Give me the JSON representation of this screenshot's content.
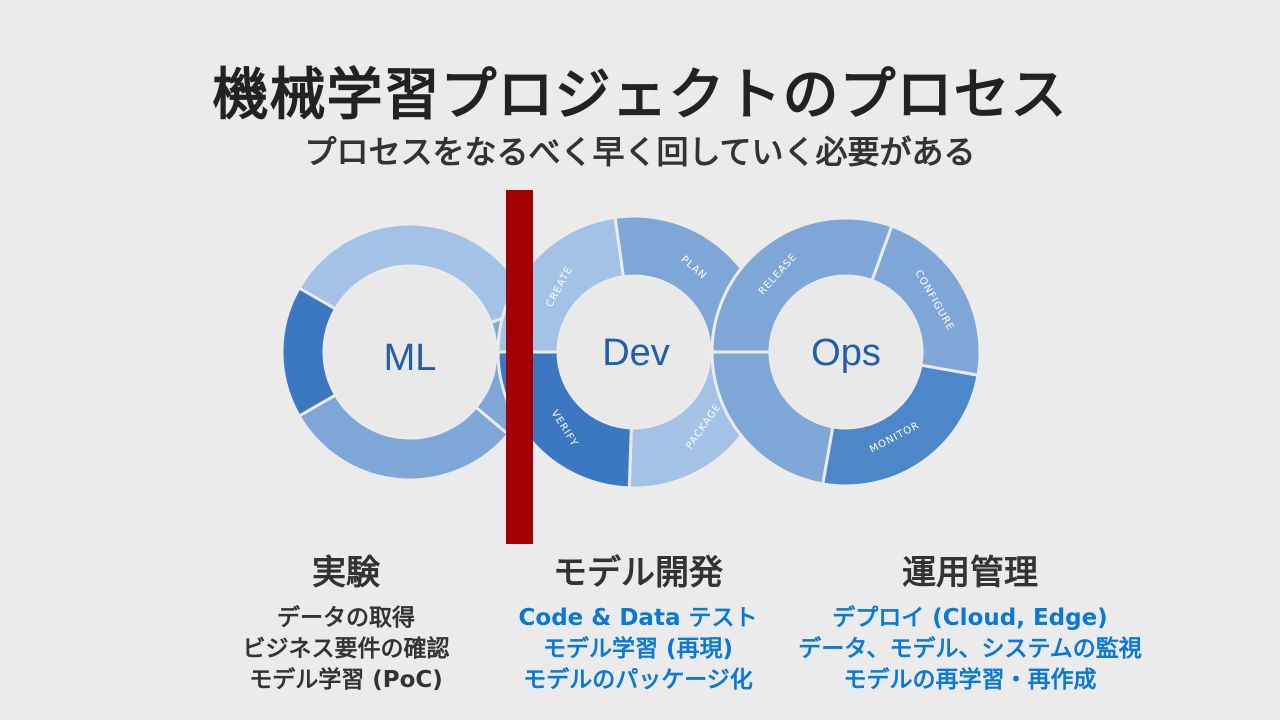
{
  "title": "機械学習プロジェクトのプロセス",
  "subtitle": "プロセスをなるべく早く回していく必要がある",
  "loops": {
    "ml": "ML",
    "dev": "Dev",
    "ops": "Ops"
  },
  "stages": {
    "create": "CREATE",
    "plan": "PLAN",
    "verify": "VERIFY",
    "package": "PACKAGE",
    "release": "RELEASE",
    "configure": "CONFIGURE",
    "monitor": "MONITOR"
  },
  "columns": [
    {
      "heading": "実験",
      "items": [
        "データの取得",
        "ビジネス要件の確認",
        "モデル学習 (PoC)"
      ]
    },
    {
      "heading": "モデル開発",
      "items": [
        "Code & Data テスト",
        "モデル学習 (再現)",
        "モデルのパッケージ化"
      ]
    },
    {
      "heading": "運用管理",
      "items": [
        "デプロイ (Cloud, Edge)",
        "データ、モデル、システムの監視",
        "モデルの再学習・再作成"
      ]
    }
  ],
  "colors": {
    "background": "#ebebeb",
    "divider": "#a30006",
    "segment_light": "#a4c2e6",
    "segment_mid": "#7ea7d8",
    "segment_dark": "#4c87c9",
    "segment_darkest": "#3c78c2",
    "loop_label": "#1e5fa8",
    "list_blue": "#0a78d4"
  }
}
